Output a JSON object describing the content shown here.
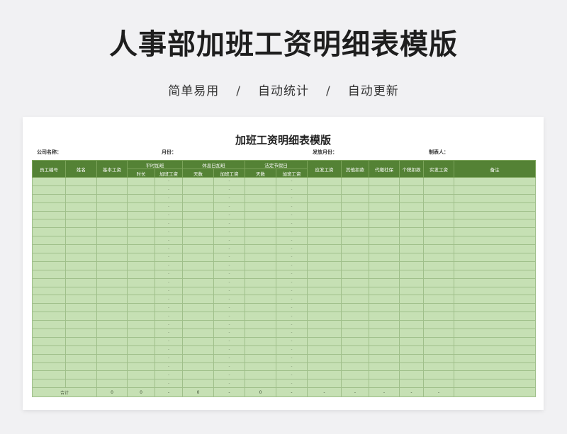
{
  "poster": {
    "title": "人事部加班工资明细表模版",
    "tags": [
      "简单易用",
      "自动统计",
      "自动更新"
    ],
    "separator": "/"
  },
  "sheet": {
    "title": "加班工资明细表模版",
    "meta": {
      "company": "公司名称：",
      "month": "月份：",
      "pay_month": "发放月份：",
      "preparer": "制表人："
    },
    "headers": {
      "employee_id": "员工编号",
      "name": "姓名",
      "base_salary": "基本工资",
      "weekday_ot": "平时加班",
      "rest_day_ot": "休息日加班",
      "holiday_ot": "法定节假日",
      "hours": "时长",
      "ot_pay": "加班工资",
      "days": "天数",
      "gross_pay": "应发工资",
      "other_deduction": "其他扣款",
      "social_insurance": "代缴社保",
      "income_tax": "个税扣款",
      "net_pay": "实发工资",
      "remarks": "备注"
    },
    "row_count": 25,
    "dash": "-",
    "totals": {
      "label": "合计",
      "base_salary": "0",
      "hours": "0",
      "ot_pay_weekday": "-",
      "days_rest": "0",
      "ot_pay_rest": "-",
      "days_holiday": "0",
      "ot_pay_holiday": "-",
      "gross_pay": "-",
      "other_deduction": "-",
      "social_insurance": "-",
      "income_tax": "-",
      "net_pay": "-"
    }
  }
}
